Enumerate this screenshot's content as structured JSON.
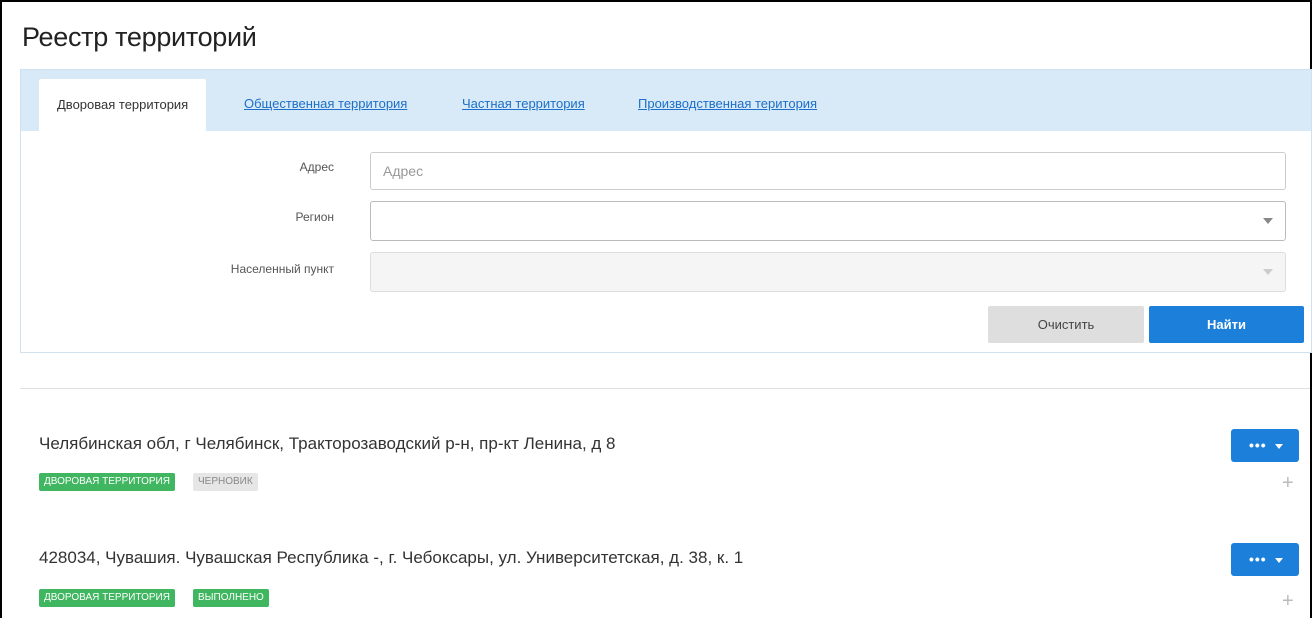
{
  "page": {
    "title": "Реестр территорий"
  },
  "tabs": [
    {
      "label": "Дворовая территория"
    },
    {
      "label": "Общественная территория"
    },
    {
      "label": "Частная территория"
    },
    {
      "label": "Производственная територия"
    }
  ],
  "form": {
    "address_label": "Адрес",
    "address_placeholder": "Адрес",
    "address_value": "",
    "region_label": "Регион",
    "region_value": "",
    "locality_label": "Населенный пункт",
    "locality_value": ""
  },
  "buttons": {
    "clear": "Очистить",
    "search": "Найти"
  },
  "items": [
    {
      "address": "Челябинская обл, г Челябинск, Тракторозаводский р-н, пр-кт Ленина, д 8",
      "type_badge": "Дворовая территория",
      "status_badge": "Черновик",
      "menu_dots": "•••"
    },
    {
      "address": "428034, Чувашия. Чувашская Республика -, г. Чебоксары, ул. Университетская, д. 38, к. 1",
      "type_badge": "Дворовая территория",
      "status_badge": "Выполнено",
      "menu_dots": "•••"
    }
  ],
  "icons": {
    "plus": "+"
  },
  "colors": {
    "accent": "#1c7fd9",
    "tab_bar": "#d8e9f7",
    "badge_green": "#3fb65f",
    "badge_gray": "#e6e6e6"
  }
}
